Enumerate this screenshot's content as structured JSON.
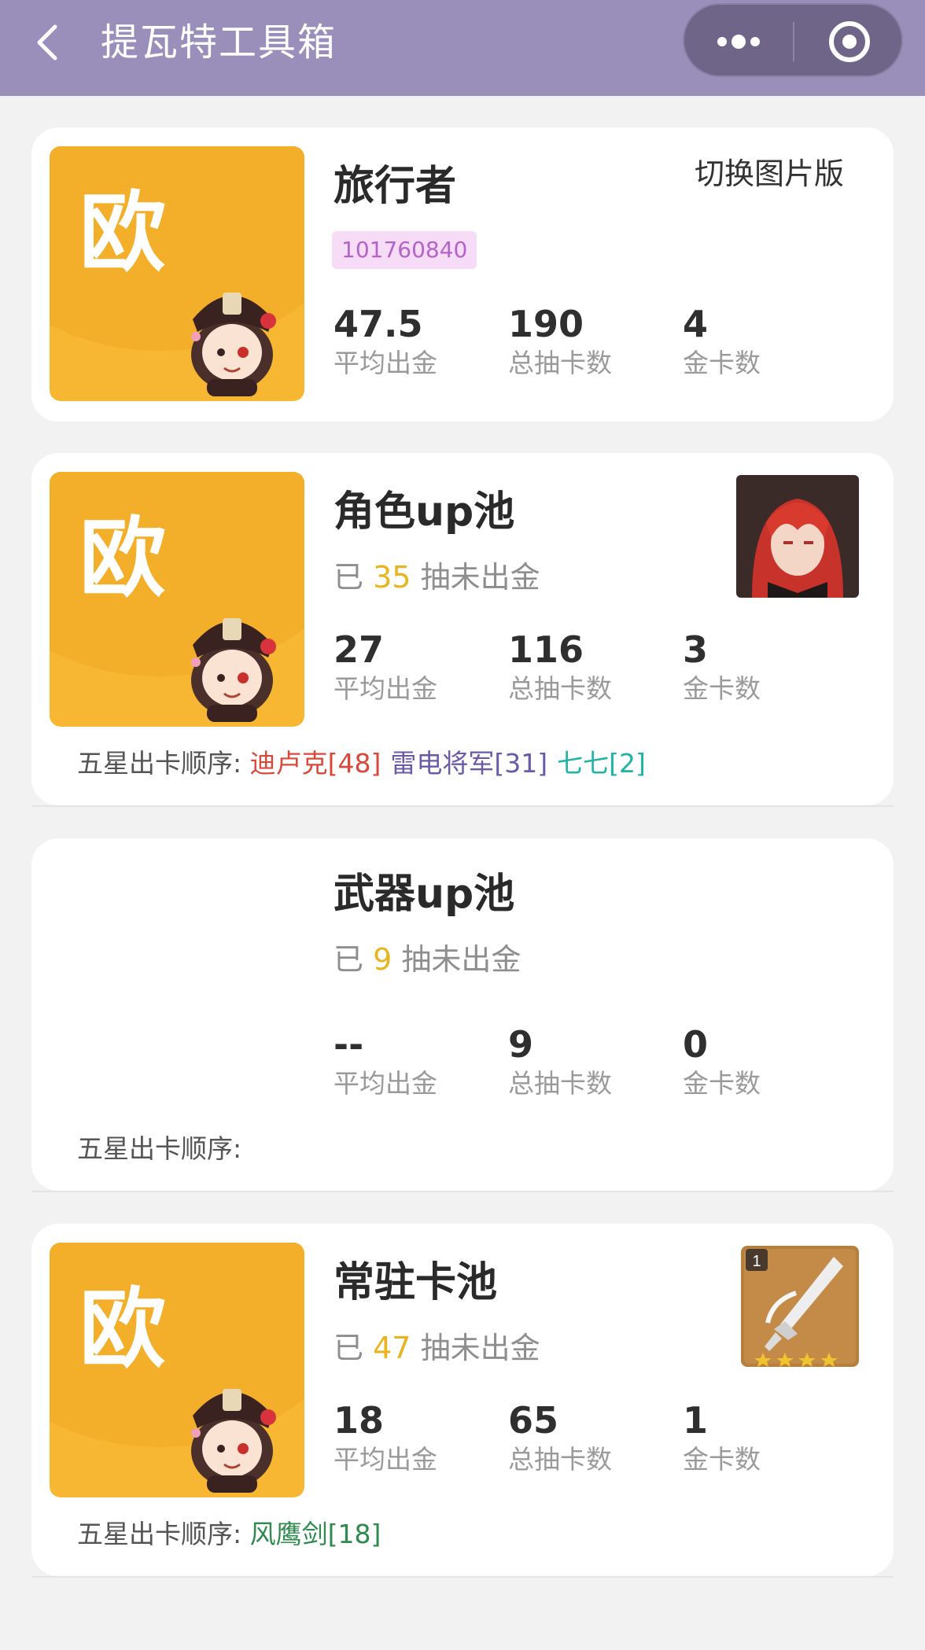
{
  "header": {
    "title": "提瓦特工具箱",
    "background": "#9a8fba"
  },
  "profile": {
    "rating": "欧",
    "name": "旅行者",
    "uid": "101760840",
    "switch_label": "切换图片版",
    "stats": [
      {
        "value": "47.5",
        "label": "平均出金"
      },
      {
        "value": "190",
        "label": "总抽卡数"
      },
      {
        "value": "4",
        "label": "金卡数"
      }
    ]
  },
  "pools": [
    {
      "rating": "欧",
      "name": "角色up池",
      "pity_prefix": "已",
      "pity_count": "35",
      "pity_suffix": "抽未出金",
      "stats": [
        {
          "value": "27",
          "label": "平均出金"
        },
        {
          "value": "116",
          "label": "总抽卡数"
        },
        {
          "value": "3",
          "label": "金卡数"
        }
      ],
      "order_label": "五星出卡顺序:",
      "order": [
        {
          "text": "迪卢克[48]",
          "color": "#d9483b"
        },
        {
          "text": "雷电将军[31]",
          "color": "#6b5aa8"
        },
        {
          "text": "七七[2]",
          "color": "#1fb5a5"
        }
      ],
      "thumb_icon": "character-portrait-icon"
    },
    {
      "rating": "",
      "name": "武器up池",
      "pity_prefix": "已",
      "pity_count": "9",
      "pity_suffix": "抽未出金",
      "stats": [
        {
          "value": "--",
          "label": "平均出金"
        },
        {
          "value": "9",
          "label": "总抽卡数"
        },
        {
          "value": "0",
          "label": "金卡数"
        }
      ],
      "order_label": "五星出卡顺序:",
      "order": []
    },
    {
      "rating": "欧",
      "name": "常驻卡池",
      "pity_prefix": "已",
      "pity_count": "47",
      "pity_suffix": "抽未出金",
      "stats": [
        {
          "value": "18",
          "label": "平均出金"
        },
        {
          "value": "65",
          "label": "总抽卡数"
        },
        {
          "value": "1",
          "label": "金卡数"
        }
      ],
      "order_label": "五星出卡顺序:",
      "order": [
        {
          "text": "风鹰剑[18]",
          "color": "#2f8a4e"
        }
      ],
      "thumb_icon": "sword-weapon-icon",
      "thumb_badge": "1"
    }
  ],
  "colors": {
    "rating_bg": "#f7b733",
    "pity_highlight": "#e8b420",
    "uid_bg": "#f6dcf6",
    "uid_text": "#b464c8"
  }
}
